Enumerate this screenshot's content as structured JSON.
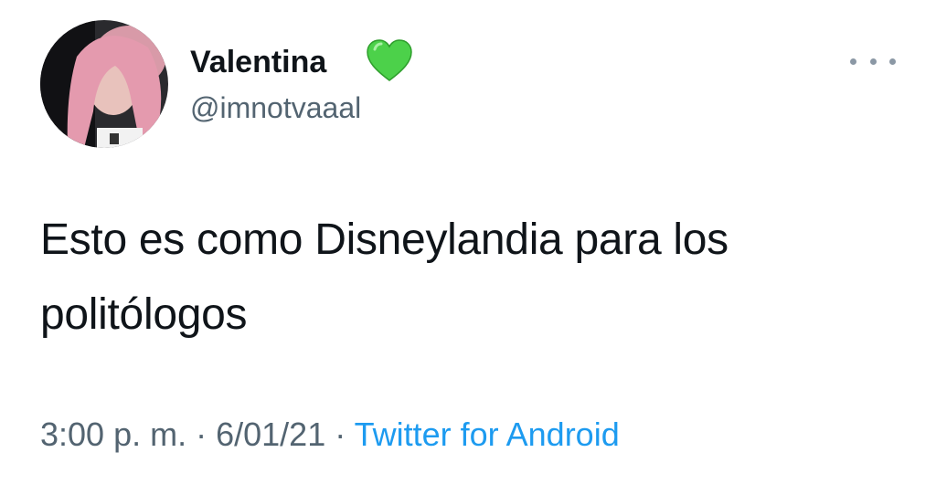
{
  "tweet": {
    "author": {
      "display_name": "Valentina",
      "verified_emoji": "green-heart",
      "handle": "@imnotvaaal"
    },
    "text_line1": "Esto es como Disneylandia para los",
    "text_line2": "politólogos",
    "meta": {
      "time": "3:00 p. m.",
      "separator": "·",
      "date": "6/01/21",
      "source": "Twitter for Android"
    }
  },
  "icons": {
    "heart": "green-heart-icon",
    "more": "more-horizontal-icon"
  },
  "colors": {
    "text_primary": "#0f1419",
    "text_secondary": "#536471",
    "link": "#1d9bf0",
    "heart": "#4cd14a"
  }
}
